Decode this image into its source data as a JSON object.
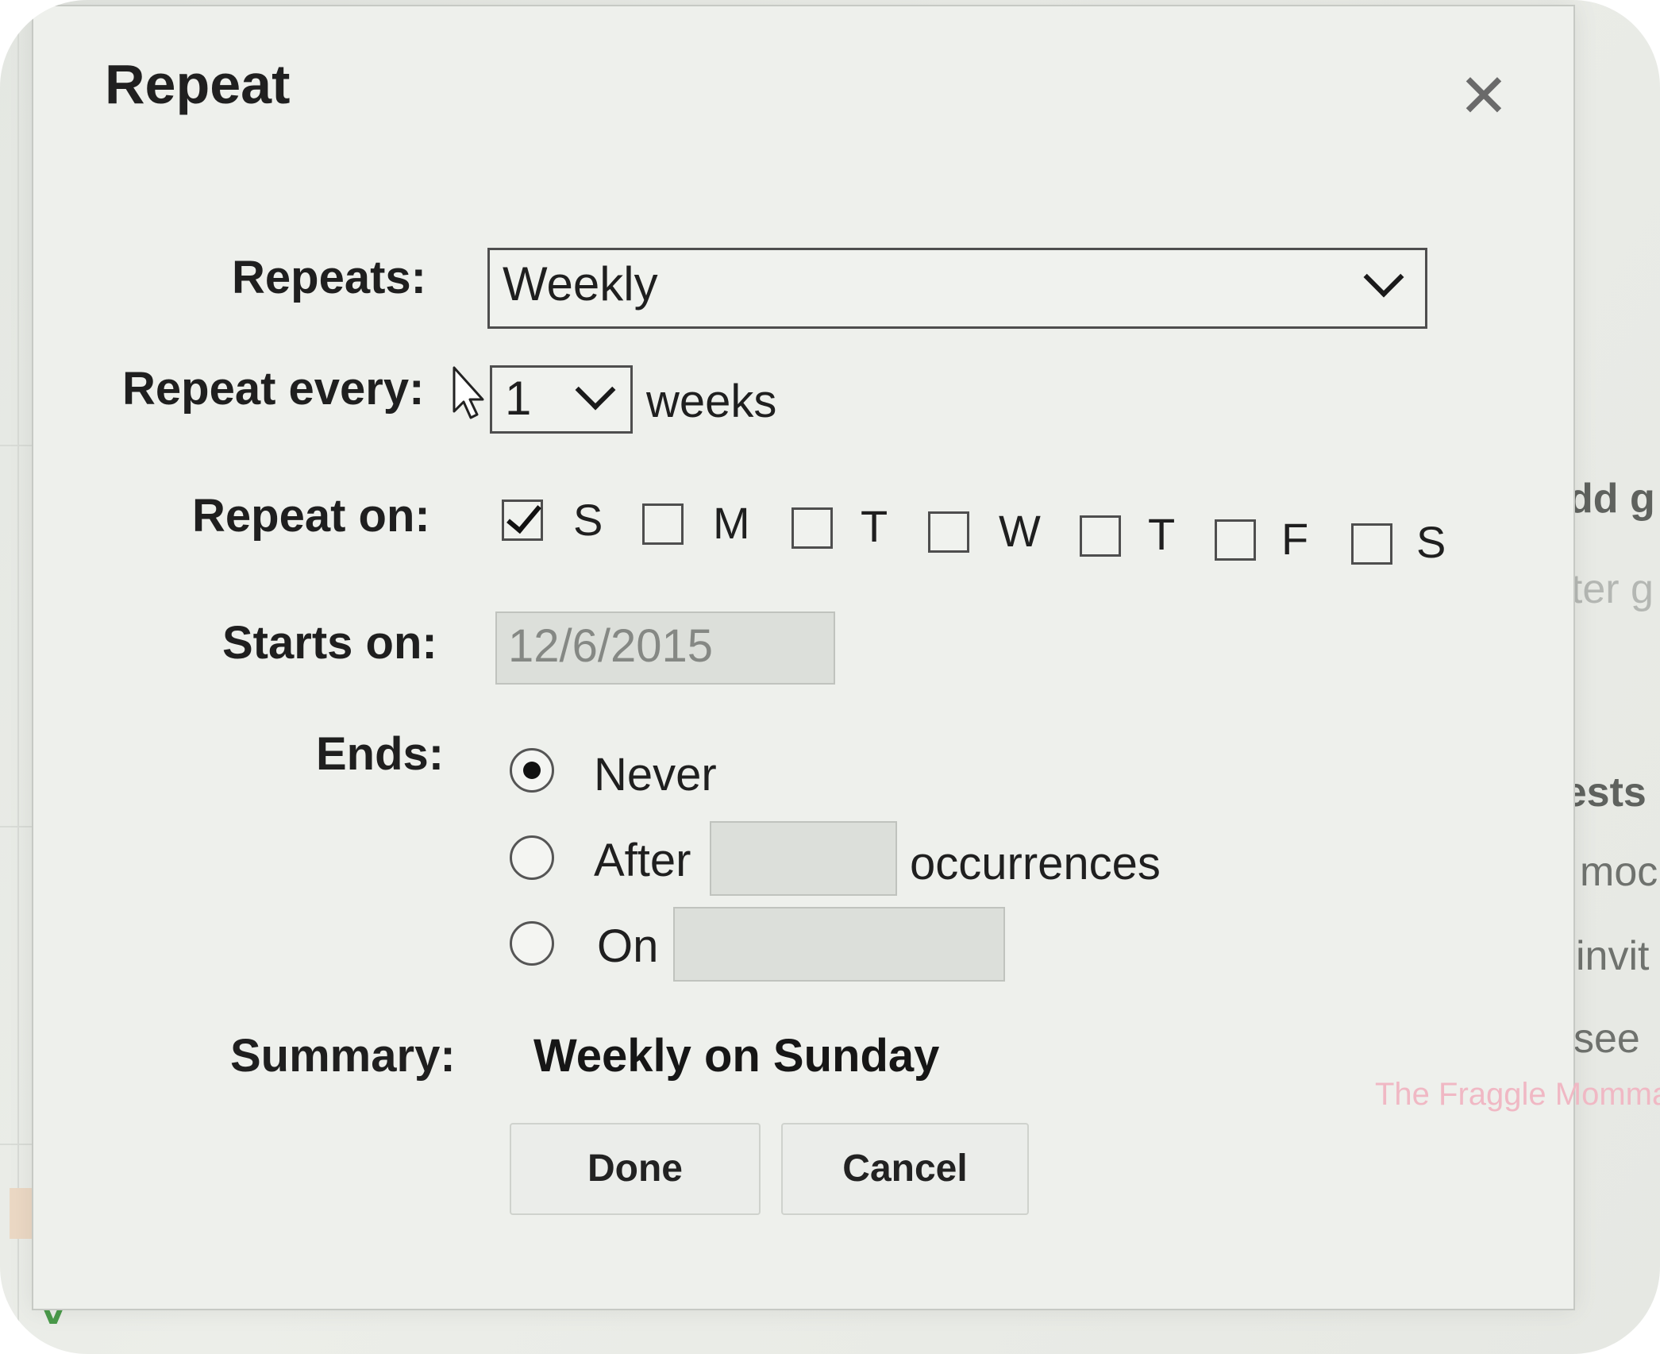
{
  "dialog": {
    "title": "Repeat",
    "close_glyph": "✕",
    "close_icon": "close-icon"
  },
  "form": {
    "repeats_label": "Repeats:",
    "repeats_value": "Weekly",
    "repeat_every_label": "Repeat every:",
    "repeat_every_value": "1",
    "repeat_every_unit": "weeks",
    "repeat_on_label": "Repeat on:",
    "days": [
      {
        "label": "S",
        "checked": true
      },
      {
        "label": "M",
        "checked": false
      },
      {
        "label": "T",
        "checked": false
      },
      {
        "label": "W",
        "checked": false
      },
      {
        "label": "T",
        "checked": false
      },
      {
        "label": "F",
        "checked": false
      },
      {
        "label": "S",
        "checked": false
      }
    ],
    "starts_on_label": "Starts on:",
    "starts_on_value": "12/6/2015",
    "ends_label": "Ends:",
    "ends_options": [
      {
        "label": "Never",
        "selected": true
      },
      {
        "label": "After",
        "selected": false,
        "suffix": "occurrences"
      },
      {
        "label": "On",
        "selected": false
      }
    ],
    "summary_label": "Summary:",
    "summary_value": "Weekly on Sunday"
  },
  "buttons": {
    "done": "Done",
    "cancel": "Cancel"
  },
  "background": {
    "add_guests_fragment": "dd g",
    "enter_guests_fragment": "nter g",
    "guests_fragment": "uests",
    "option1_fragment": "moc",
    "option2_fragment": "invit",
    "option3_fragment": "see"
  },
  "watermark": "The Fraggle Momma",
  "colors": {
    "dialog_bg": "#eef0ec",
    "text": "#1f1f1f",
    "disabled_input": "#dcdfda",
    "watermark": "#f0b8c4"
  }
}
